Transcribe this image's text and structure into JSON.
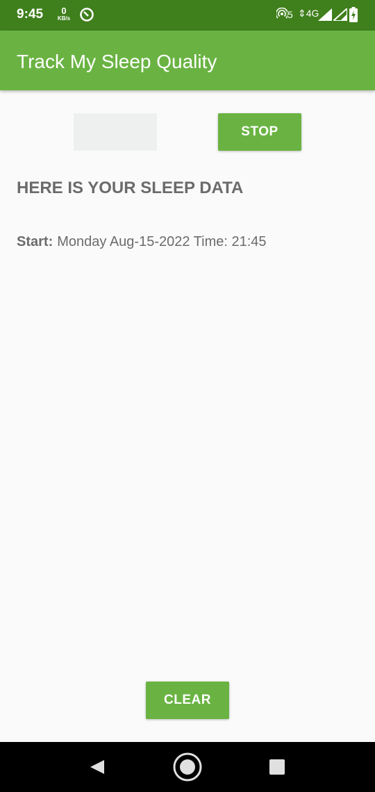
{
  "status_bar": {
    "time": "9:45",
    "data_speed": "0",
    "data_unit": "KB/s",
    "hotspot_count": "5",
    "network": "4G",
    "icons": [
      "app-notification-icon",
      "hotspot-icon",
      "signal-icon",
      "battery-charging-icon"
    ]
  },
  "app_bar": {
    "title": "Track My Sleep Quality"
  },
  "buttons": {
    "start_label": "",
    "stop_label": "STOP",
    "clear_label": "CLEAR"
  },
  "sleep_data": {
    "heading": "HERE IS YOUR SLEEP DATA",
    "start_label": "Start:",
    "start_value": "Monday Aug-15-2022 Time: 21:45"
  },
  "nav_bar": {
    "icons": [
      "back-icon",
      "home-icon",
      "recents-icon"
    ]
  },
  "colors": {
    "status_bar": "#3f7f1c",
    "primary": "#6ab343",
    "background": "#fafafa",
    "text_secondary": "#6b6b6b",
    "disabled_button": "#eeefef"
  }
}
